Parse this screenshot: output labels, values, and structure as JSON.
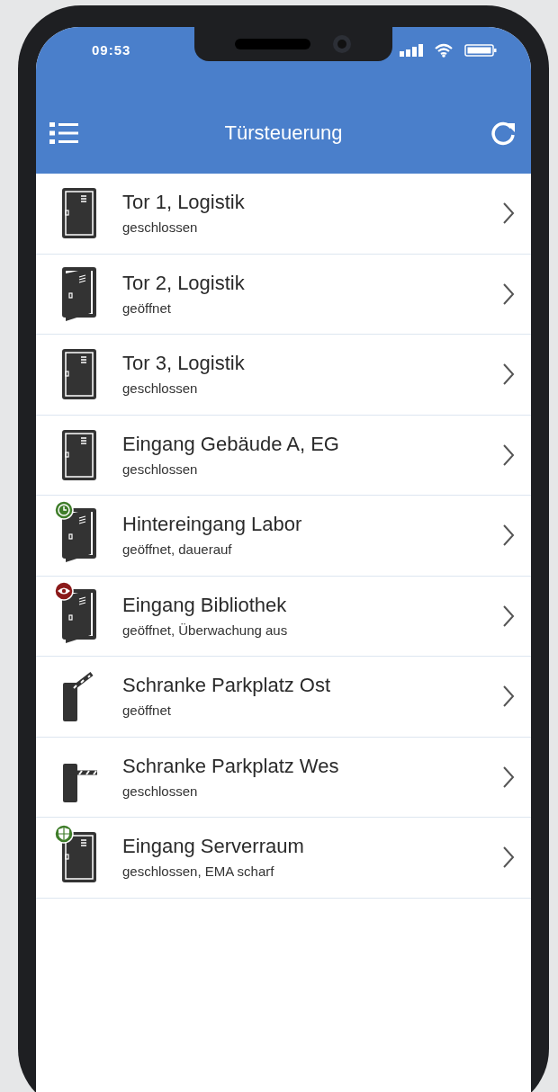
{
  "status_bar": {
    "time": "09:53"
  },
  "header": {
    "title": "Türsteuerung"
  },
  "items": [
    {
      "title": "Tor 1, Logistik",
      "status": "geschlossen",
      "kind": "door_closed"
    },
    {
      "title": "Tor 2, Logistik",
      "status": "geöffnet",
      "kind": "door_open"
    },
    {
      "title": "Tor 3, Logistik",
      "status": "geschlossen",
      "kind": "door_closed"
    },
    {
      "title": "Eingang Gebäude A, EG",
      "status": "geschlossen",
      "kind": "door_closed"
    },
    {
      "title": "Hintereingang Labor",
      "status": "geöffnet, dauerauf",
      "kind": "door_open_timer"
    },
    {
      "title": "Eingang Bibliothek",
      "status": "geöffnet, Überwachung aus",
      "kind": "door_open_unwatched"
    },
    {
      "title": "Schranke Parkplatz Ost",
      "status": "geöffnet",
      "kind": "barrier_open"
    },
    {
      "title": "Schranke Parkplatz Wes",
      "status": "geschlossen",
      "kind": "barrier_closed"
    },
    {
      "title": "Eingang Serverraum",
      "status": "geschlossen, EMA scharf",
      "kind": "door_closed_armed"
    }
  ]
}
